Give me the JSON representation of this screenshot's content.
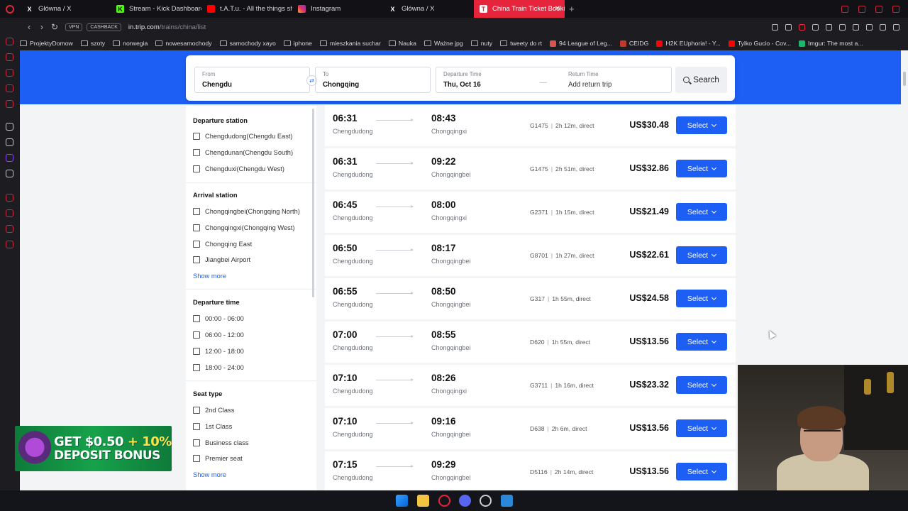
{
  "browser": {
    "tabs": [
      {
        "label": "Główna / X",
        "icon": "x-icon"
      },
      {
        "label": "Stream - Kick Dashboard",
        "icon": "kick-icon"
      },
      {
        "label": "t.A.T.u. - All the things sh",
        "icon": "youtube-icon"
      },
      {
        "label": "Instagram",
        "icon": "instagram-icon"
      },
      {
        "label": "Główna / X",
        "icon": "x-icon"
      },
      {
        "label": "China Train Ticket Bookin",
        "icon": "trip-icon"
      }
    ],
    "vpn_label": "VPN",
    "cashback_label": "CASHBACK",
    "url_host": "in.trip.com",
    "url_path": "/trains/china/list",
    "bookmarks": [
      "ProjektyDomow",
      "szoty",
      "norwegia",
      "nowesamochody",
      "samochody xayo",
      "iphone",
      "mieszkania suchar",
      "Nauka",
      "Ważne jpg",
      "nuty",
      "tweety do rt",
      "94 League of Leg...",
      "CEIDG",
      "H2K EUphoria! - Y...",
      "Tylko Gucio - Cov...",
      "Imgur: The most a..."
    ]
  },
  "search": {
    "from_label": "From",
    "from_value": "Chengdu",
    "to_label": "To",
    "to_value": "Chongqing",
    "departure_label": "Departure Time",
    "departure_value": "Thu, Oct 16",
    "return_label": "Return Time",
    "return_value": "Add return trip",
    "search_button": "Search"
  },
  "filters": {
    "departure_station": {
      "title": "Departure station",
      "options": [
        "Chengdudong(Chengdu East)",
        "Chengdunan(Chengdu South)",
        "Chengduxi(Chengdu West)"
      ]
    },
    "arrival_station": {
      "title": "Arrival station",
      "options": [
        "Chongqingbei(Chongqing North)",
        "Chongqingxi(Chongqing West)",
        "Chongqing East",
        "Jiangbei Airport"
      ],
      "more": "Show more"
    },
    "departure_time": {
      "title": "Departure time",
      "options": [
        "00:00 - 06:00",
        "06:00 - 12:00",
        "12:00 - 18:00",
        "18:00 - 24:00"
      ]
    },
    "seat_type": {
      "title": "Seat type",
      "options": [
        "2nd Class",
        "1st Class",
        "Business class",
        "Premier seat"
      ],
      "more": "Show more"
    }
  },
  "trains": [
    {
      "dep": "06:31",
      "dep_station": "Chengdudong",
      "arr": "08:43",
      "arr_station": "Chongqingxi",
      "number": "G1475",
      "duration": "2h 12m, direct",
      "price": "US$30.48",
      "select": "Select"
    },
    {
      "dep": "06:31",
      "dep_station": "Chengdudong",
      "arr": "09:22",
      "arr_station": "Chongqingbei",
      "number": "G1475",
      "duration": "2h 51m, direct",
      "price": "US$32.86",
      "select": "Select"
    },
    {
      "dep": "06:45",
      "dep_station": "Chengdudong",
      "arr": "08:00",
      "arr_station": "Chongqingxi",
      "number": "G2371",
      "duration": "1h 15m, direct",
      "price": "US$21.49",
      "select": "Select"
    },
    {
      "dep": "06:50",
      "dep_station": "Chengdudong",
      "arr": "08:17",
      "arr_station": "Chongqingbei",
      "number": "G8701",
      "duration": "1h 27m, direct",
      "price": "US$22.61",
      "select": "Select"
    },
    {
      "dep": "06:55",
      "dep_station": "Chengdudong",
      "arr": "08:50",
      "arr_station": "Chongqingbei",
      "number": "G317",
      "duration": "1h 55m, direct",
      "price": "US$24.58",
      "select": "Select"
    },
    {
      "dep": "07:00",
      "dep_station": "Chengdudong",
      "arr": "08:55",
      "arr_station": "Chongqingbei",
      "number": "D620",
      "duration": "1h 55m, direct",
      "price": "US$13.56",
      "select": "Select"
    },
    {
      "dep": "07:10",
      "dep_station": "Chengdudong",
      "arr": "08:26",
      "arr_station": "Chongqingxi",
      "number": "G3711",
      "duration": "1h 16m, direct",
      "price": "US$23.32",
      "select": "Select"
    },
    {
      "dep": "07:10",
      "dep_station": "Chengdudong",
      "arr": "09:16",
      "arr_station": "Chongqingbei",
      "number": "D638",
      "duration": "2h 6m, direct",
      "price": "US$13.56",
      "select": "Select"
    },
    {
      "dep": "07:15",
      "dep_station": "Chengdudong",
      "arr": "09:29",
      "arr_station": "Chongqingbei",
      "number": "D5116",
      "duration": "2h 14m, direct",
      "price": "US$13.56",
      "select": "Select"
    }
  ],
  "ad": {
    "line1a": "GET $0.50",
    "line1b": "+ 10%",
    "line2": "DEPOSIT BONUS"
  },
  "colors": {
    "brand_blue": "#1d5ff5",
    "opera_red": "#e6243c"
  }
}
